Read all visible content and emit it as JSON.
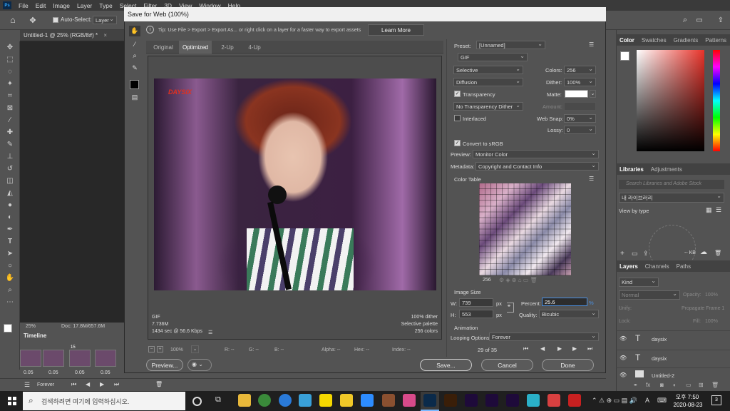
{
  "menubar": {
    "logo": "Ps",
    "items": [
      "File",
      "Edit",
      "Image",
      "Layer",
      "Type",
      "Select",
      "Filter",
      "3D",
      "View",
      "Window",
      "Help"
    ]
  },
  "optbar": {
    "auto_select_label": "Auto-Select:",
    "auto_select_value": "Layer"
  },
  "doc_tab": {
    "title": "Untitled-1 @ 25% (RGB/8#) *"
  },
  "statusbar": {
    "zoom": "25%",
    "doc_info": "Doc: 17.8M/657.6M"
  },
  "timeline": {
    "label": "Timeline",
    "frames": [
      {
        "num": "",
        "delay": "0.05"
      },
      {
        "num": "",
        "delay": "0.05"
      },
      {
        "num": "15",
        "delay": "0.05"
      },
      {
        "num": "",
        "delay": "0.05"
      }
    ],
    "loop": "Forever"
  },
  "dialog": {
    "title": "Save for Web (100%)",
    "tip": "Tip: Use File > Export > Export As... or right click on a layer for a faster way to export assets",
    "learn_more": "Learn More",
    "view_tabs": [
      "Original",
      "Optimized",
      "2-Up",
      "4-Up"
    ],
    "active_tab": "Optimized",
    "image_watermark": "DAYSIX",
    "preview_info": {
      "format": "GIF",
      "size": "7.736M",
      "time": "1434 sec @ 56.6 Kbps",
      "dither": "100% dither",
      "palette": "Selective palette",
      "colors": "256 colors"
    },
    "bottom_bar": {
      "zoom": "100%",
      "r": "R: --",
      "g": "G: --",
      "b": "B: --",
      "alpha": "Alpha: --",
      "hex": "Hex: --",
      "index": "Index: --"
    },
    "buttons": {
      "preview": "Preview...",
      "save": "Save...",
      "cancel": "Cancel",
      "done": "Done"
    },
    "settings": {
      "preset_label": "Preset:",
      "preset_value": "[Unnamed]",
      "format": "GIF",
      "reduction": "Selective",
      "colors_label": "Colors:",
      "colors_value": "256",
      "dither_algo": "Diffusion",
      "dither_label": "Dither:",
      "dither_value": "100%",
      "transparency_label": "Transparency",
      "matte_label": "Matte:",
      "transp_dither": "No Transparency Dither",
      "amount_label": "Amount:",
      "interlaced_label": "Interlaced",
      "websnap_label": "Web Snap:",
      "websnap_value": "0%",
      "lossy_label": "Lossy:",
      "lossy_value": "0",
      "convert_srgb": "Convert to sRGB",
      "preview_label": "Preview:",
      "preview_value": "Monitor Color",
      "metadata_label": "Metadata:",
      "metadata_value": "Copyright and Contact Info"
    },
    "color_table": {
      "label": "Color Table",
      "count": "256"
    },
    "image_size": {
      "label": "Image Size",
      "w_label": "W:",
      "w_value": "739",
      "h_label": "H:",
      "h_value": "553",
      "unit": "px",
      "percent_label": "Percent:",
      "percent_value": "25.6",
      "percent_unit": "%",
      "quality_label": "Quality:",
      "quality_value": "Bicubic"
    },
    "animation": {
      "label": "Animation",
      "looping_label": "Looping Options:",
      "looping_value": "Forever",
      "frame_counter": "29 of 35"
    }
  },
  "right_panels": {
    "color_tabs": [
      "Color",
      "Swatches",
      "Gradients",
      "Patterns"
    ],
    "libraries_tabs": [
      "Libraries",
      "Adjustments"
    ],
    "library_search_placeholder": "Search Libraries and Adobe Stock",
    "library_name": "내 라이브러리",
    "view_by": "View by type",
    "kb": "-- KB",
    "layers_tabs": [
      "Layers",
      "Channels",
      "Paths"
    ],
    "kind": "Kind",
    "blend": "Normal",
    "opacity_label": "Opacity:",
    "opacity_value": "100%",
    "unify_label": "Unify:",
    "propagate": "Propagate Frame 1",
    "lock_label": "Lock:",
    "fill_label": "Fill:",
    "fill_value": "100%",
    "layers": [
      "daysix",
      "daysix",
      "Untitled-2"
    ]
  },
  "taskbar": {
    "search_placeholder": "검색하려면 여기에 입력하십시오.",
    "time": "오후 7:50",
    "date": "2020-08-23",
    "ime": "A",
    "notif": "3"
  }
}
